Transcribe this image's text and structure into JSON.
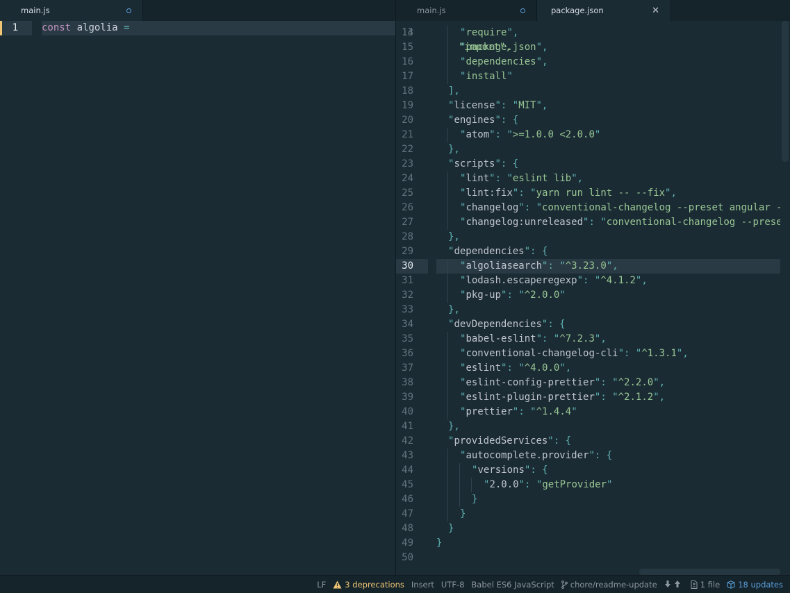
{
  "tabs": {
    "left": [
      {
        "title": "main.js",
        "modified": true,
        "active": true
      }
    ],
    "right": [
      {
        "title": "main.js",
        "modified": true,
        "active": false
      },
      {
        "title": "package.json",
        "modified": false,
        "active": true
      }
    ]
  },
  "left_editor": {
    "lines": [
      {
        "num": "1",
        "tokens": [
          {
            "t": "const",
            "c": "keyword"
          },
          {
            "t": " algolia ",
            "c": "ident"
          },
          {
            "t": "=",
            "c": "op"
          }
        ]
      }
    ]
  },
  "right_editor": {
    "partial_top_line": "\"import\",",
    "cursor_line": "30",
    "lines": [
      {
        "num": "14",
        "indent": 2,
        "tokens": [
          {
            "t": "\"",
            "c": "quote"
          },
          {
            "t": "require",
            "c": "string"
          },
          {
            "t": "\"",
            "c": "quote"
          },
          {
            "t": ",",
            "c": "punct"
          }
        ]
      },
      {
        "num": "15",
        "indent": 2,
        "tokens": [
          {
            "t": "\"",
            "c": "quote"
          },
          {
            "t": "package.json",
            "c": "string"
          },
          {
            "t": "\"",
            "c": "quote"
          },
          {
            "t": ",",
            "c": "punct"
          }
        ]
      },
      {
        "num": "16",
        "indent": 2,
        "tokens": [
          {
            "t": "\"",
            "c": "quote"
          },
          {
            "t": "dependencies",
            "c": "string"
          },
          {
            "t": "\"",
            "c": "quote"
          },
          {
            "t": ",",
            "c": "punct"
          }
        ]
      },
      {
        "num": "17",
        "indent": 2,
        "tokens": [
          {
            "t": "\"",
            "c": "quote"
          },
          {
            "t": "install",
            "c": "string"
          },
          {
            "t": "\"",
            "c": "quote"
          }
        ]
      },
      {
        "num": "18",
        "indent": 1,
        "tokens": [
          {
            "t": "],",
            "c": "punct"
          }
        ]
      },
      {
        "num": "19",
        "indent": 1,
        "tokens": [
          {
            "t": "\"",
            "c": "quote"
          },
          {
            "t": "license",
            "c": "key"
          },
          {
            "t": "\"",
            "c": "quote"
          },
          {
            "t": ": ",
            "c": "punct"
          },
          {
            "t": "\"",
            "c": "quote"
          },
          {
            "t": "MIT",
            "c": "string"
          },
          {
            "t": "\"",
            "c": "quote"
          },
          {
            "t": ",",
            "c": "punct"
          }
        ]
      },
      {
        "num": "20",
        "indent": 1,
        "tokens": [
          {
            "t": "\"",
            "c": "quote"
          },
          {
            "t": "engines",
            "c": "key"
          },
          {
            "t": "\"",
            "c": "quote"
          },
          {
            "t": ": {",
            "c": "punct"
          }
        ]
      },
      {
        "num": "21",
        "indent": 2,
        "tokens": [
          {
            "t": "\"",
            "c": "quote"
          },
          {
            "t": "atom",
            "c": "key"
          },
          {
            "t": "\"",
            "c": "quote"
          },
          {
            "t": ": ",
            "c": "punct"
          },
          {
            "t": "\"",
            "c": "quote"
          },
          {
            "t": ">=1.0.0 <2.0.0",
            "c": "string"
          },
          {
            "t": "\"",
            "c": "quote"
          }
        ]
      },
      {
        "num": "22",
        "indent": 1,
        "tokens": [
          {
            "t": "},",
            "c": "punct"
          }
        ]
      },
      {
        "num": "23",
        "indent": 1,
        "tokens": [
          {
            "t": "\"",
            "c": "quote"
          },
          {
            "t": "scripts",
            "c": "key"
          },
          {
            "t": "\"",
            "c": "quote"
          },
          {
            "t": ": {",
            "c": "punct"
          }
        ]
      },
      {
        "num": "24",
        "indent": 2,
        "tokens": [
          {
            "t": "\"",
            "c": "quote"
          },
          {
            "t": "lint",
            "c": "key"
          },
          {
            "t": "\"",
            "c": "quote"
          },
          {
            "t": ": ",
            "c": "punct"
          },
          {
            "t": "\"",
            "c": "quote"
          },
          {
            "t": "eslint lib",
            "c": "string"
          },
          {
            "t": "\"",
            "c": "quote"
          },
          {
            "t": ",",
            "c": "punct"
          }
        ]
      },
      {
        "num": "25",
        "indent": 2,
        "tokens": [
          {
            "t": "\"",
            "c": "quote"
          },
          {
            "t": "lint:fix",
            "c": "key"
          },
          {
            "t": "\"",
            "c": "quote"
          },
          {
            "t": ": ",
            "c": "punct"
          },
          {
            "t": "\"",
            "c": "quote"
          },
          {
            "t": "yarn run lint -- --fix",
            "c": "string"
          },
          {
            "t": "\"",
            "c": "quote"
          },
          {
            "t": ",",
            "c": "punct"
          }
        ]
      },
      {
        "num": "26",
        "indent": 2,
        "tokens": [
          {
            "t": "\"",
            "c": "quote"
          },
          {
            "t": "changelog",
            "c": "key"
          },
          {
            "t": "\"",
            "c": "quote"
          },
          {
            "t": ": ",
            "c": "punct"
          },
          {
            "t": "\"",
            "c": "quote"
          },
          {
            "t": "conventional-changelog --preset angular -",
            "c": "string"
          }
        ]
      },
      {
        "num": "27",
        "indent": 2,
        "tokens": [
          {
            "t": "\"",
            "c": "quote"
          },
          {
            "t": "changelog:unreleased",
            "c": "key"
          },
          {
            "t": "\"",
            "c": "quote"
          },
          {
            "t": ": ",
            "c": "punct"
          },
          {
            "t": "\"",
            "c": "quote"
          },
          {
            "t": "conventional-changelog --prese",
            "c": "string"
          }
        ]
      },
      {
        "num": "28",
        "indent": 1,
        "tokens": [
          {
            "t": "},",
            "c": "punct"
          }
        ]
      },
      {
        "num": "29",
        "indent": 1,
        "tokens": [
          {
            "t": "\"",
            "c": "quote"
          },
          {
            "t": "dependencies",
            "c": "key"
          },
          {
            "t": "\"",
            "c": "quote"
          },
          {
            "t": ": {",
            "c": "punct"
          }
        ]
      },
      {
        "num": "30",
        "indent": 2,
        "tokens": [
          {
            "t": "\"",
            "c": "quote"
          },
          {
            "t": "algoliasearch",
            "c": "key"
          },
          {
            "t": "\"",
            "c": "quote"
          },
          {
            "t": ": ",
            "c": "punct"
          },
          {
            "t": "\"",
            "c": "quote"
          },
          {
            "t": "^3.23.0",
            "c": "string"
          },
          {
            "t": "\"",
            "c": "quote"
          },
          {
            "t": ",",
            "c": "punct"
          }
        ]
      },
      {
        "num": "31",
        "indent": 2,
        "tokens": [
          {
            "t": "\"",
            "c": "quote"
          },
          {
            "t": "lodash.escaperegexp",
            "c": "key"
          },
          {
            "t": "\"",
            "c": "quote"
          },
          {
            "t": ": ",
            "c": "punct"
          },
          {
            "t": "\"",
            "c": "quote"
          },
          {
            "t": "^4.1.2",
            "c": "string"
          },
          {
            "t": "\"",
            "c": "quote"
          },
          {
            "t": ",",
            "c": "punct"
          }
        ]
      },
      {
        "num": "32",
        "indent": 2,
        "tokens": [
          {
            "t": "\"",
            "c": "quote"
          },
          {
            "t": "pkg-up",
            "c": "key"
          },
          {
            "t": "\"",
            "c": "quote"
          },
          {
            "t": ": ",
            "c": "punct"
          },
          {
            "t": "\"",
            "c": "quote"
          },
          {
            "t": "^2.0.0",
            "c": "string"
          },
          {
            "t": "\"",
            "c": "quote"
          }
        ]
      },
      {
        "num": "33",
        "indent": 1,
        "tokens": [
          {
            "t": "},",
            "c": "punct"
          }
        ]
      },
      {
        "num": "34",
        "indent": 1,
        "tokens": [
          {
            "t": "\"",
            "c": "quote"
          },
          {
            "t": "devDependencies",
            "c": "key"
          },
          {
            "t": "\"",
            "c": "quote"
          },
          {
            "t": ": {",
            "c": "punct"
          }
        ]
      },
      {
        "num": "35",
        "indent": 2,
        "tokens": [
          {
            "t": "\"",
            "c": "quote"
          },
          {
            "t": "babel-eslint",
            "c": "key"
          },
          {
            "t": "\"",
            "c": "quote"
          },
          {
            "t": ": ",
            "c": "punct"
          },
          {
            "t": "\"",
            "c": "quote"
          },
          {
            "t": "^7.2.3",
            "c": "string"
          },
          {
            "t": "\"",
            "c": "quote"
          },
          {
            "t": ",",
            "c": "punct"
          }
        ]
      },
      {
        "num": "36",
        "indent": 2,
        "tokens": [
          {
            "t": "\"",
            "c": "quote"
          },
          {
            "t": "conventional-changelog-cli",
            "c": "key"
          },
          {
            "t": "\"",
            "c": "quote"
          },
          {
            "t": ": ",
            "c": "punct"
          },
          {
            "t": "\"",
            "c": "quote"
          },
          {
            "t": "^1.3.1",
            "c": "string"
          },
          {
            "t": "\"",
            "c": "quote"
          },
          {
            "t": ",",
            "c": "punct"
          }
        ]
      },
      {
        "num": "37",
        "indent": 2,
        "tokens": [
          {
            "t": "\"",
            "c": "quote"
          },
          {
            "t": "eslint",
            "c": "key"
          },
          {
            "t": "\"",
            "c": "quote"
          },
          {
            "t": ": ",
            "c": "punct"
          },
          {
            "t": "\"",
            "c": "quote"
          },
          {
            "t": "^4.0.0",
            "c": "string"
          },
          {
            "t": "\"",
            "c": "quote"
          },
          {
            "t": ",",
            "c": "punct"
          }
        ]
      },
      {
        "num": "38",
        "indent": 2,
        "tokens": [
          {
            "t": "\"",
            "c": "quote"
          },
          {
            "t": "eslint-config-prettier",
            "c": "key"
          },
          {
            "t": "\"",
            "c": "quote"
          },
          {
            "t": ": ",
            "c": "punct"
          },
          {
            "t": "\"",
            "c": "quote"
          },
          {
            "t": "^2.2.0",
            "c": "string"
          },
          {
            "t": "\"",
            "c": "quote"
          },
          {
            "t": ",",
            "c": "punct"
          }
        ]
      },
      {
        "num": "39",
        "indent": 2,
        "tokens": [
          {
            "t": "\"",
            "c": "quote"
          },
          {
            "t": "eslint-plugin-prettier",
            "c": "key"
          },
          {
            "t": "\"",
            "c": "quote"
          },
          {
            "t": ": ",
            "c": "punct"
          },
          {
            "t": "\"",
            "c": "quote"
          },
          {
            "t": "^2.1.2",
            "c": "string"
          },
          {
            "t": "\"",
            "c": "quote"
          },
          {
            "t": ",",
            "c": "punct"
          }
        ]
      },
      {
        "num": "40",
        "indent": 2,
        "tokens": [
          {
            "t": "\"",
            "c": "quote"
          },
          {
            "t": "prettier",
            "c": "key"
          },
          {
            "t": "\"",
            "c": "quote"
          },
          {
            "t": ": ",
            "c": "punct"
          },
          {
            "t": "\"",
            "c": "quote"
          },
          {
            "t": "^1.4.4",
            "c": "string"
          },
          {
            "t": "\"",
            "c": "quote"
          }
        ]
      },
      {
        "num": "41",
        "indent": 1,
        "tokens": [
          {
            "t": "},",
            "c": "punct"
          }
        ]
      },
      {
        "num": "42",
        "indent": 1,
        "tokens": [
          {
            "t": "\"",
            "c": "quote"
          },
          {
            "t": "providedServices",
            "c": "key"
          },
          {
            "t": "\"",
            "c": "quote"
          },
          {
            "t": ": {",
            "c": "punct"
          }
        ]
      },
      {
        "num": "43",
        "indent": 2,
        "tokens": [
          {
            "t": "\"",
            "c": "quote"
          },
          {
            "t": "autocomplete.provider",
            "c": "key"
          },
          {
            "t": "\"",
            "c": "quote"
          },
          {
            "t": ": {",
            "c": "punct"
          }
        ]
      },
      {
        "num": "44",
        "indent": 3,
        "tokens": [
          {
            "t": "\"",
            "c": "quote"
          },
          {
            "t": "versions",
            "c": "key"
          },
          {
            "t": "\"",
            "c": "quote"
          },
          {
            "t": ": {",
            "c": "punct"
          }
        ]
      },
      {
        "num": "45",
        "indent": 4,
        "tokens": [
          {
            "t": "\"",
            "c": "quote"
          },
          {
            "t": "2.0.0",
            "c": "key"
          },
          {
            "t": "\"",
            "c": "quote"
          },
          {
            "t": ": ",
            "c": "punct"
          },
          {
            "t": "\"",
            "c": "quote"
          },
          {
            "t": "getProvider",
            "c": "string"
          },
          {
            "t": "\"",
            "c": "quote"
          }
        ]
      },
      {
        "num": "46",
        "indent": 3,
        "tokens": [
          {
            "t": "}",
            "c": "punct"
          }
        ]
      },
      {
        "num": "47",
        "indent": 2,
        "tokens": [
          {
            "t": "}",
            "c": "punct"
          }
        ]
      },
      {
        "num": "48",
        "indent": 1,
        "tokens": [
          {
            "t": "}",
            "c": "punct"
          }
        ]
      },
      {
        "num": "49",
        "indent": 0,
        "tokens": [
          {
            "t": "}",
            "c": "punct"
          }
        ]
      },
      {
        "num": "50",
        "indent": 0,
        "tokens": []
      }
    ]
  },
  "status_bar": {
    "line_ending": "LF",
    "deprecations": "3 deprecations",
    "mode": "Insert",
    "encoding": "UTF-8",
    "grammar": "Babel ES6 JavaScript",
    "branch": "chore/readme-update",
    "changed_files": "1 file",
    "updates": "18 updates"
  },
  "colors": {
    "background": "#1b2b34",
    "tab_bar": "#15232b",
    "cursor_marker": "#f0c674",
    "accent_blue": "#5a9fd9",
    "string": "#99c794",
    "keyword": "#c594c5",
    "punctuation": "#5fb3b3"
  }
}
